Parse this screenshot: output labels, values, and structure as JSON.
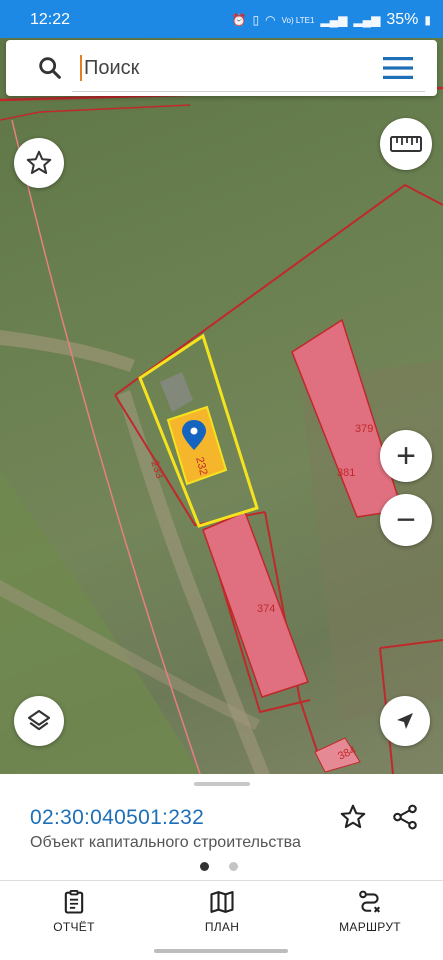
{
  "status_bar": {
    "time": "12:22",
    "battery": "35%",
    "network": "Vo) LTE1"
  },
  "search": {
    "placeholder": "Поиск",
    "value": ""
  },
  "map": {
    "parcel_labels": [
      "232",
      "233",
      "374",
      "379",
      "381",
      "384"
    ],
    "colors": {
      "boundary": "#c0292b",
      "selected_outline": "#f4e31d",
      "selected_fill": "#f6b62b",
      "building": "#e0707f",
      "marker": "#1565c0"
    }
  },
  "map_controls": {
    "favorite_icon": "star-outline-icon",
    "ruler_icon": "ruler-icon",
    "zoom_in_label": "+",
    "zoom_out_label": "−",
    "layers_icon": "layers-icon",
    "location_icon": "navigation-arrow-icon"
  },
  "object": {
    "cadastral_number": "02:30:040501:232",
    "type": "Объект капитального строительства",
    "pages": 2,
    "active_page": 1
  },
  "bottom_nav": {
    "items": [
      {
        "label": "ОТЧЁТ",
        "icon": "report-clipboard-icon"
      },
      {
        "label": "ПЛАН",
        "icon": "map-plan-icon"
      },
      {
        "label": "МАРШРУТ",
        "icon": "route-icon"
      }
    ]
  }
}
